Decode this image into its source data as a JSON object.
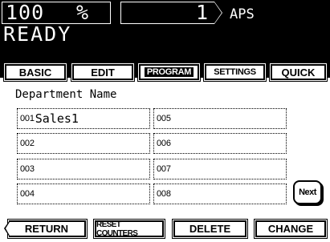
{
  "status": {
    "zoom_value": "100",
    "zoom_unit": "%",
    "copies": "1",
    "paper": "APS",
    "message": "READY"
  },
  "tabs": [
    {
      "label": "BASIC",
      "active": false
    },
    {
      "label": "EDIT",
      "active": false
    },
    {
      "label": "PROGRAM",
      "active": true
    },
    {
      "label": "SETTINGS",
      "active": false
    },
    {
      "label": "QUICK",
      "active": false
    }
  ],
  "panel": {
    "header": "Department Name",
    "departments": [
      {
        "num": "001",
        "name": "Sales1"
      },
      {
        "num": "002",
        "name": ""
      },
      {
        "num": "003",
        "name": ""
      },
      {
        "num": "004",
        "name": ""
      },
      {
        "num": "005",
        "name": ""
      },
      {
        "num": "006",
        "name": ""
      },
      {
        "num": "007",
        "name": ""
      },
      {
        "num": "008",
        "name": ""
      }
    ],
    "next_label": "Next"
  },
  "buttons": {
    "return": "RETURN",
    "reset": "RESET COUNTERS",
    "delete": "DELETE",
    "change": "CHANGE"
  }
}
